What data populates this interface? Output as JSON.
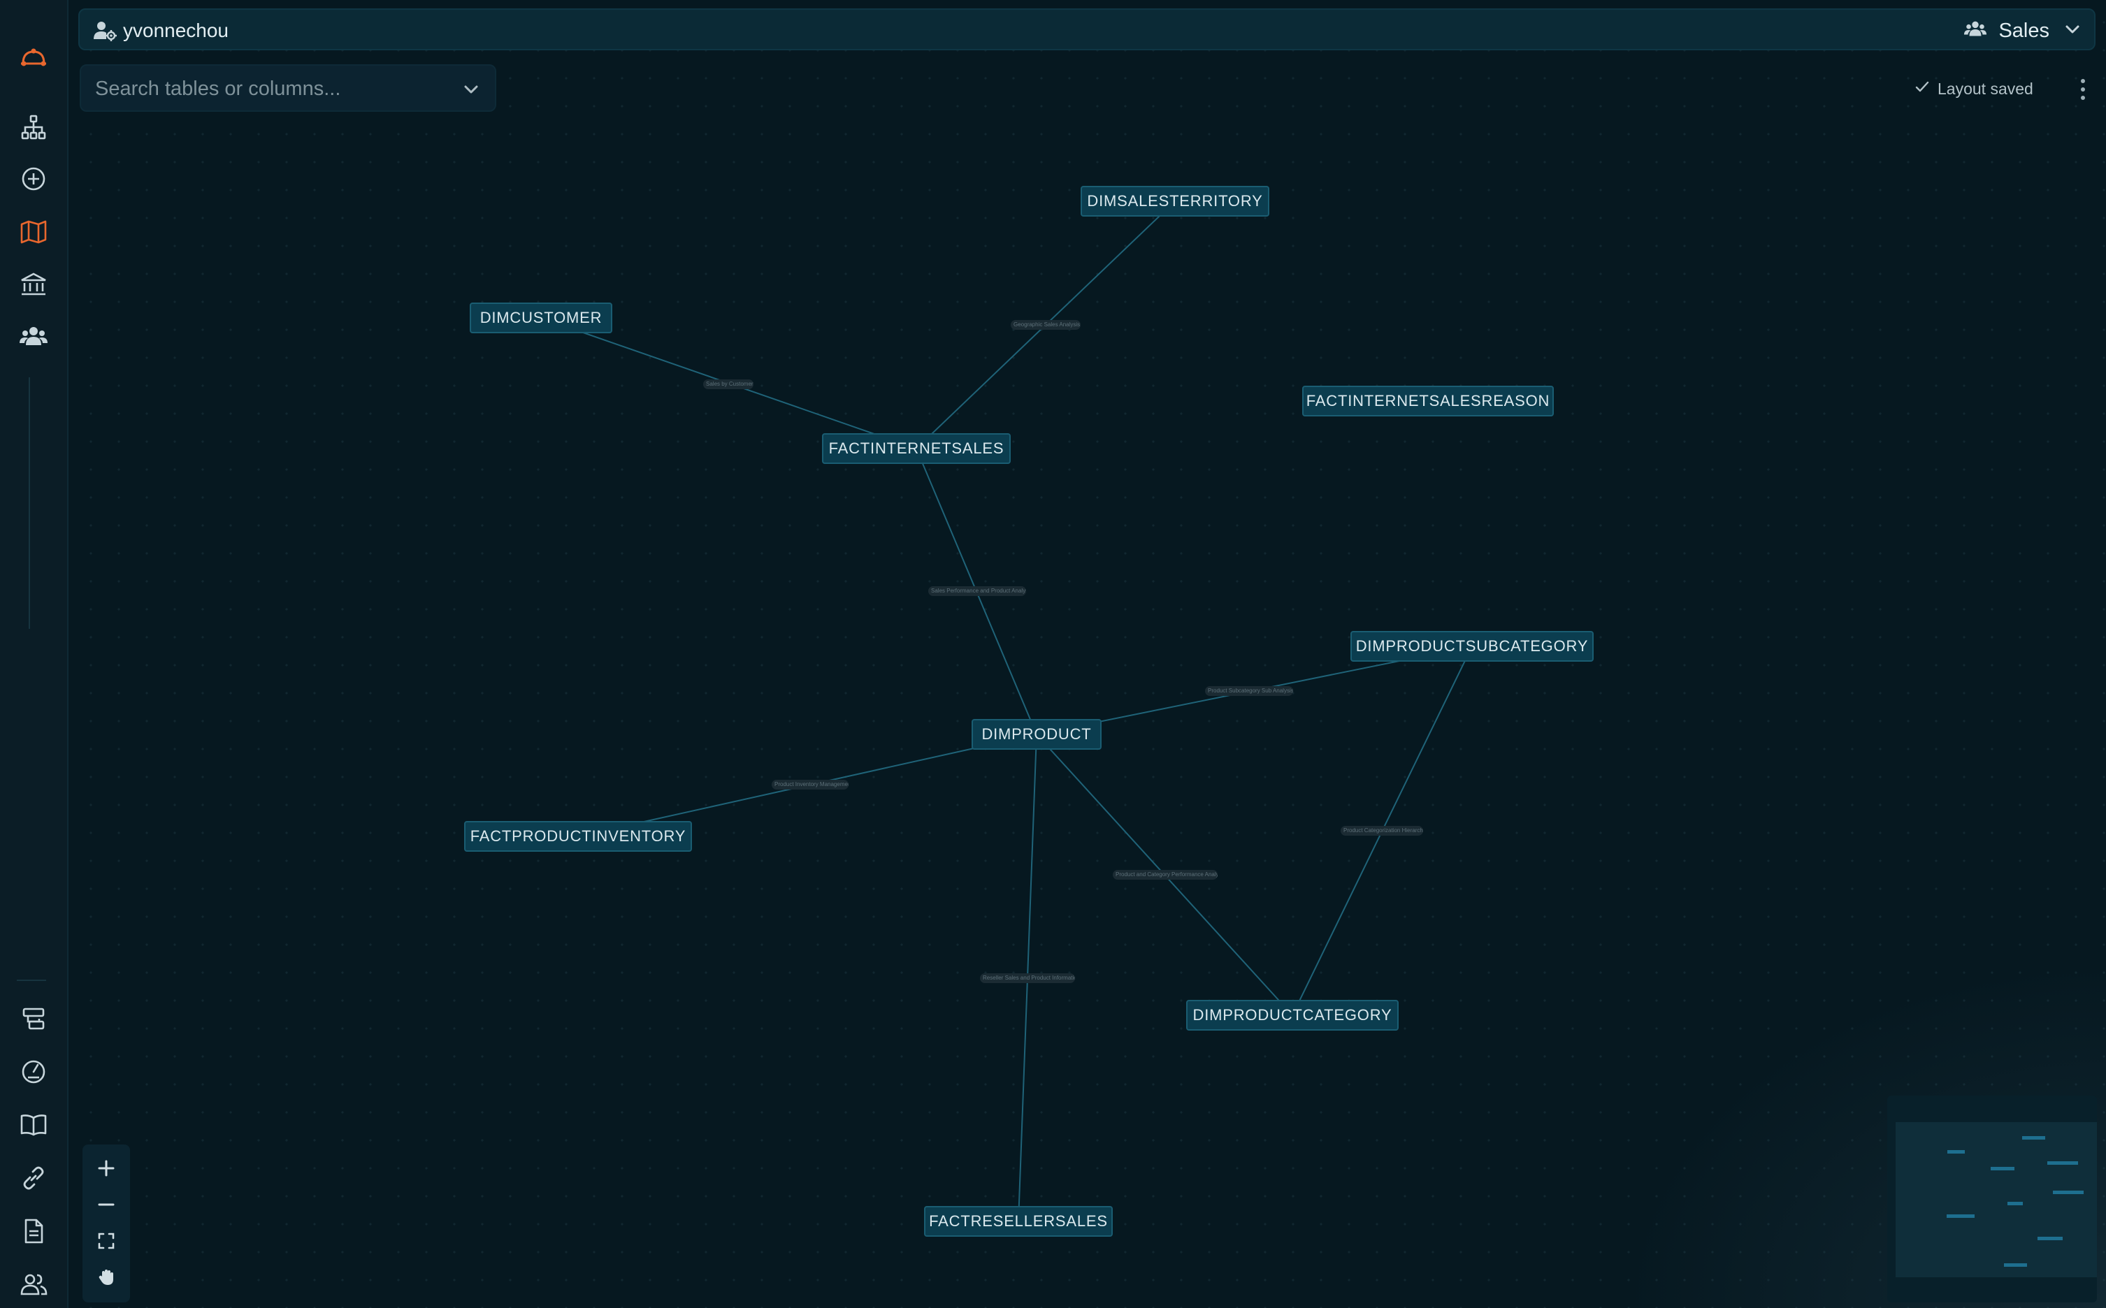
{
  "user": {
    "name": "yvonnechou",
    "icon": "user-gear-icon"
  },
  "workspace": {
    "label": "Sales",
    "icon": "users-icon"
  },
  "search": {
    "placeholder": "Search tables or columns..."
  },
  "status": {
    "text": "Layout saved",
    "icon": "check-icon"
  },
  "sidebar": {
    "top_items": [
      {
        "name": "logo-icon"
      },
      {
        "name": "hierarchy-icon"
      },
      {
        "name": "add-circle-icon"
      },
      {
        "name": "map-icon",
        "active": true
      },
      {
        "name": "bank-icon"
      },
      {
        "name": "users-icon"
      }
    ],
    "bottom_items": [
      {
        "name": "chat-stack-icon"
      },
      {
        "name": "gauge-icon"
      },
      {
        "name": "book-icon"
      },
      {
        "name": "link-icon"
      },
      {
        "name": "document-icon"
      },
      {
        "name": "people-icon"
      }
    ]
  },
  "graph": {
    "nodes": [
      {
        "id": "dimsalesterritory",
        "label": "DIMSALESTERRITORY"
      },
      {
        "id": "dimcustomer",
        "label": "DIMCUSTOMER"
      },
      {
        "id": "factinternetsalesreason",
        "label": "FACTINTERNETSALESREASON"
      },
      {
        "id": "factinternetsales",
        "label": "FACTINTERNETSALES"
      },
      {
        "id": "dimproductsubcategory",
        "label": "DIMPRODUCTSUBCATEGORY"
      },
      {
        "id": "dimproduct",
        "label": "DIMPRODUCT"
      },
      {
        "id": "factproductinventory",
        "label": "FACTPRODUCTINVENTORY"
      },
      {
        "id": "dimproductcategory",
        "label": "DIMPRODUCTCATEGORY"
      },
      {
        "id": "factresellersales",
        "label": "FACTRESELLERSALES"
      }
    ],
    "edges": [
      {
        "from": "factinternetsales",
        "to": "dimsalesterritory",
        "label": "Geographic Sales Analysis"
      },
      {
        "from": "factinternetsales",
        "to": "dimcustomer",
        "label": "Sales by Customer"
      },
      {
        "from": "factinternetsales",
        "to": "dimproduct",
        "label": "Sales Performance and Product Analysis"
      },
      {
        "from": "dimproduct",
        "to": "dimproductsubcategory",
        "label": "Product Subcategory Sub Analysis"
      },
      {
        "from": "dimproduct",
        "to": "factproductinventory",
        "label": "Product Inventory Management"
      },
      {
        "from": "dimproduct",
        "to": "dimproductcategory",
        "label": "Product and Category Performance Analysis"
      },
      {
        "from": "dimproductsubcategory",
        "to": "dimproductcategory",
        "label": "Product Categorization Hierarchy"
      },
      {
        "from": "dimproduct",
        "to": "factresellersales",
        "label": "Reseller Sales and Product Information"
      }
    ]
  },
  "controls": {
    "zoom_in": "plus-icon",
    "zoom_out": "minus-icon",
    "fit_view": "fit-view-icon",
    "pan": "hand-icon"
  }
}
